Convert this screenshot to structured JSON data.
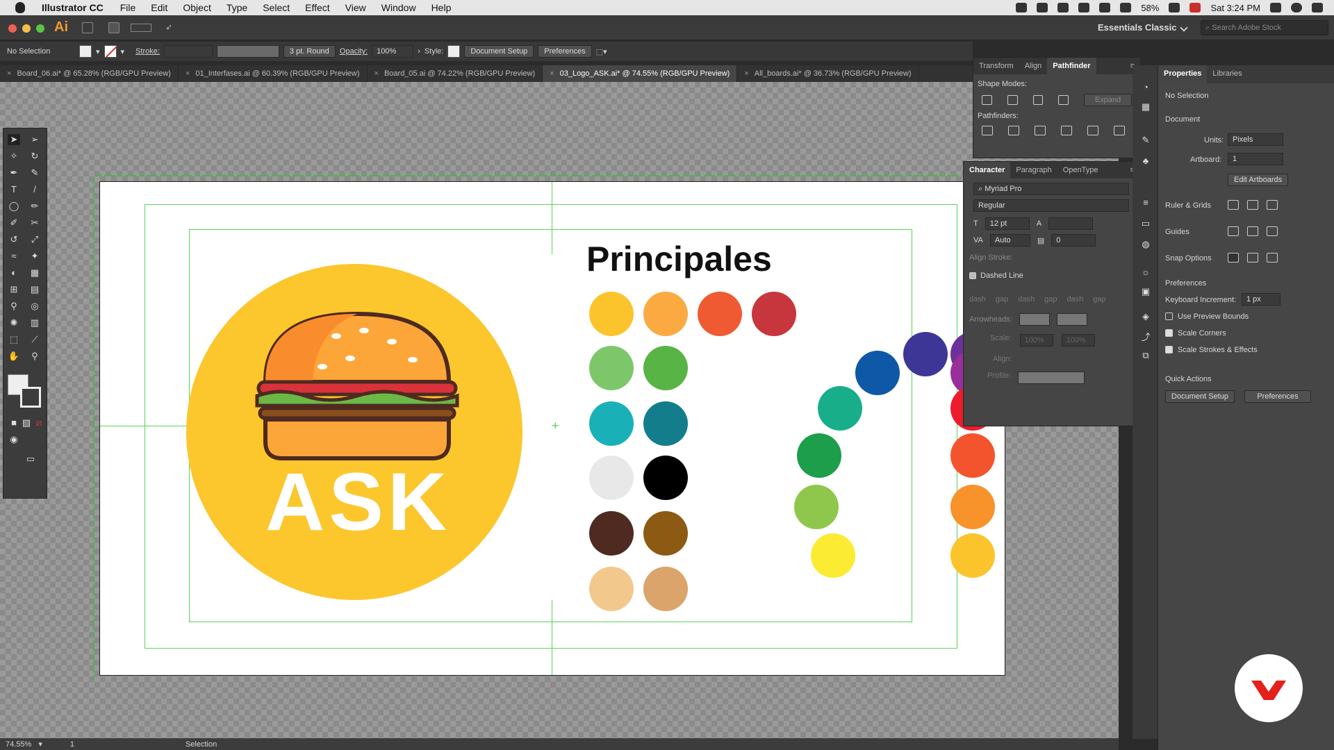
{
  "menubar": {
    "app_name": "Illustrator CC",
    "items": [
      "File",
      "Edit",
      "Object",
      "Type",
      "Select",
      "Effect",
      "View",
      "Window",
      "Help"
    ],
    "battery": "58%",
    "clock": "Sat 3:24 PM"
  },
  "workspace": {
    "label": "Essentials Classic",
    "search_placeholder": "Search Adobe Stock"
  },
  "control": {
    "selection": "No Selection",
    "stroke_label": "Stroke:",
    "brush": "3 pt. Round",
    "opacity_label": "Opacity:",
    "opacity": "100%",
    "style_label": "Style:",
    "doc_setup": "Document Setup",
    "preferences": "Preferences"
  },
  "tabs": [
    {
      "label": "Board_06.ai* @ 65.28% (RGB/GPU Preview)"
    },
    {
      "label": "01_Interfases.ai @ 60.39% (RGB/GPU Preview)"
    },
    {
      "label": "Board_05.ai @ 74.22% (RGB/GPU Preview)"
    },
    {
      "label": "03_Logo_ASK.ai* @ 74.55% (RGB/GPU Preview)"
    },
    {
      "label": "All_boards.ai* @ 36.73% (RGB/GPU Preview)"
    }
  ],
  "artboard": {
    "heading": "Principales",
    "logo_text": "ASK",
    "swatches": [
      "#fcc42c",
      "#fbaa42",
      "#ef5a33",
      "#c8363d",
      "#7dc76a",
      "#58b445",
      "#1ab0b8",
      "#137d8c",
      "#e8e8e8",
      "#000000",
      "#4e2a20",
      "#8c5a13",
      "#f2c88d",
      "#dba46a"
    ],
    "wheel": [
      "#fbec33",
      "#8fc74c",
      "#1c9e4a",
      "#18ae8a",
      "#0f58a8",
      "#3e3697",
      "#6e319a",
      "#982f9a",
      "#ed1c2d",
      "#f4542d",
      "#f8922b",
      "#fcc42c"
    ]
  },
  "pathfinder": {
    "tabs": [
      "Transform",
      "Align",
      "Pathfinder"
    ],
    "shape_modes": "Shape Modes:",
    "expand": "Expand",
    "pathfinders": "Pathfinders:"
  },
  "character": {
    "tabs": [
      "Character",
      "Paragraph",
      "OpenType"
    ],
    "font": "Myriad Pro",
    "style": "Regular",
    "size": "12 pt",
    "leading": "Auto",
    "tracking": "0",
    "align_stroke": "Align Stroke:",
    "dashed_line": "Dashed Line",
    "dash": "dash",
    "gap": "gap",
    "arrowheads": "Arrowheads:",
    "scale": "Scale:",
    "scale_a": "100%",
    "scale_b": "100%",
    "align": "Align:",
    "profile": "Profile:"
  },
  "properties": {
    "tabs": [
      "Properties",
      "Libraries"
    ],
    "selection": "No Selection",
    "document": "Document",
    "units_label": "Units:",
    "units": "Pixels",
    "artboard_label": "Artboard:",
    "artboard": "1",
    "edit_artboards": "Edit Artboards",
    "rulers": "Ruler & Grids",
    "guides": "Guides",
    "snap": "Snap Options",
    "preferences": "Preferences",
    "keyboard_label": "Keyboard Increment:",
    "keyboard": "1 px",
    "use_preview": "Use Preview Bounds",
    "scale_corners": "Scale Corners",
    "scale_strokes": "Scale Strokes & Effects",
    "quick_actions": "Quick Actions",
    "doc_setup": "Document Setup",
    "prefs_btn": "Preferences"
  },
  "statusbar": {
    "zoom": "74.55%",
    "artboard": "1",
    "tool": "Selection"
  }
}
